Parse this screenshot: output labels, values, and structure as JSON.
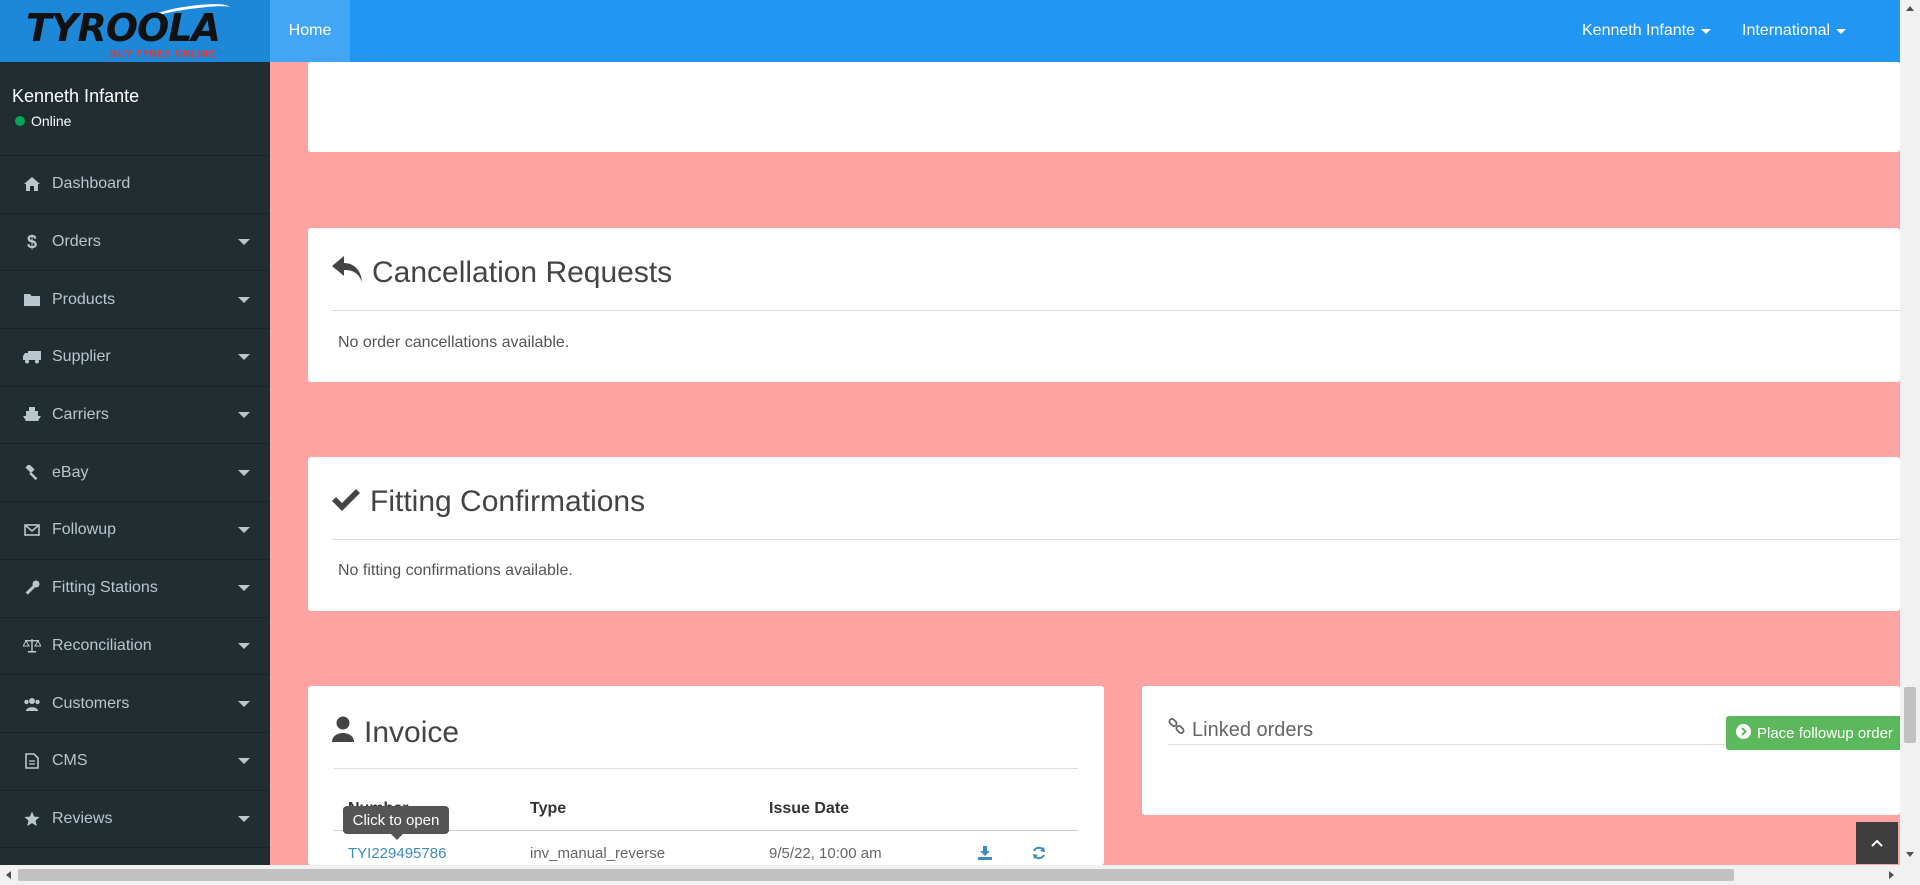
{
  "header": {
    "logo_text": "TYROOLA",
    "logo_subtext": "BUY TYRES ONLINE",
    "home_label": "Home",
    "user_menu_label": "Kenneth Infante",
    "region_menu_label": "International",
    "accent_color": "#2196f3"
  },
  "sidebar": {
    "user_name": "Kenneth Infante",
    "user_status": "Online",
    "items": [
      {
        "label": "Dashboard",
        "icon": "home-icon"
      },
      {
        "label": "Orders",
        "icon": "dollar-icon"
      },
      {
        "label": "Products",
        "icon": "folder-icon"
      },
      {
        "label": "Supplier",
        "icon": "truck-icon"
      },
      {
        "label": "Carriers",
        "icon": "ship-icon"
      },
      {
        "label": "eBay",
        "icon": "gavel-icon"
      },
      {
        "label": "Followup",
        "icon": "envelope-icon"
      },
      {
        "label": "Fitting Stations",
        "icon": "wrench-icon"
      },
      {
        "label": "Reconciliation",
        "icon": "balance-scale-icon"
      },
      {
        "label": "Customers",
        "icon": "users-icon"
      },
      {
        "label": "CMS",
        "icon": "file-icon"
      },
      {
        "label": "Reviews",
        "icon": "star-icon"
      }
    ]
  },
  "main": {
    "cancellation": {
      "title": "Cancellation Requests",
      "empty_text": "No order cancellations available."
    },
    "fitting": {
      "title": "Fitting Confirmations",
      "empty_text": "No fitting confirmations available."
    },
    "invoice": {
      "title": "Invoice",
      "columns": [
        "Number",
        "Type",
        "Issue Date"
      ],
      "rows": [
        {
          "number": "TYI229495786",
          "type": "inv_manual_reverse",
          "issue_date": "9/5/22, 10:00 am"
        }
      ],
      "tooltip": "Click to open"
    },
    "linked_orders": {
      "title": "Linked orders",
      "followup_button": "Place followup order"
    },
    "background_color": "#ffa3a3"
  }
}
